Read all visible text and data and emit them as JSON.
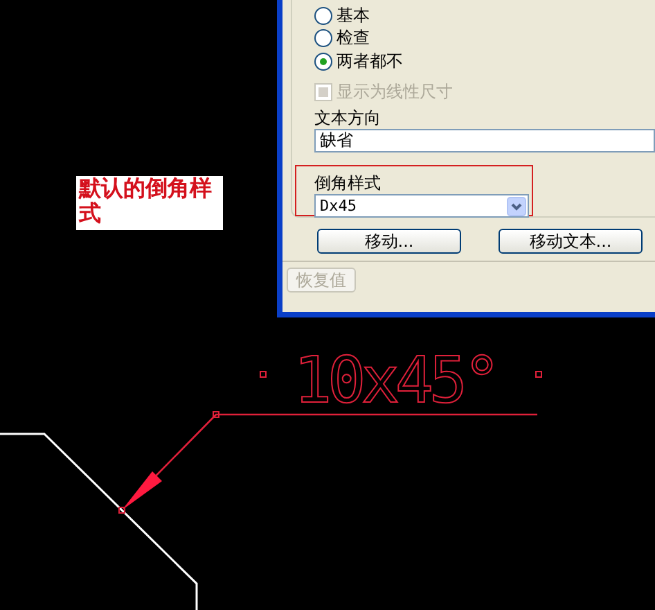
{
  "dialog": {
    "radios": [
      {
        "label": "基本",
        "selected": false
      },
      {
        "label": "检查",
        "selected": false
      },
      {
        "label": "两者都不",
        "selected": true
      }
    ],
    "checkbox": {
      "label": "显示为线性尺寸",
      "checked": false,
      "disabled": true
    },
    "text_direction": {
      "label": "文本方向",
      "value": "缺省"
    },
    "chamfer_style": {
      "label": "倒角样式",
      "value": "Dx45",
      "highlighted": true
    },
    "buttons": [
      {
        "label": "移动...",
        "disabled": false
      },
      {
        "label": "移动文本...",
        "disabled": false
      }
    ],
    "reset_button": {
      "label": "恢复值",
      "disabled": true
    }
  },
  "callout": {
    "text": "默认的倒角样式"
  },
  "drawing": {
    "dimension_text": "10x45°"
  }
}
